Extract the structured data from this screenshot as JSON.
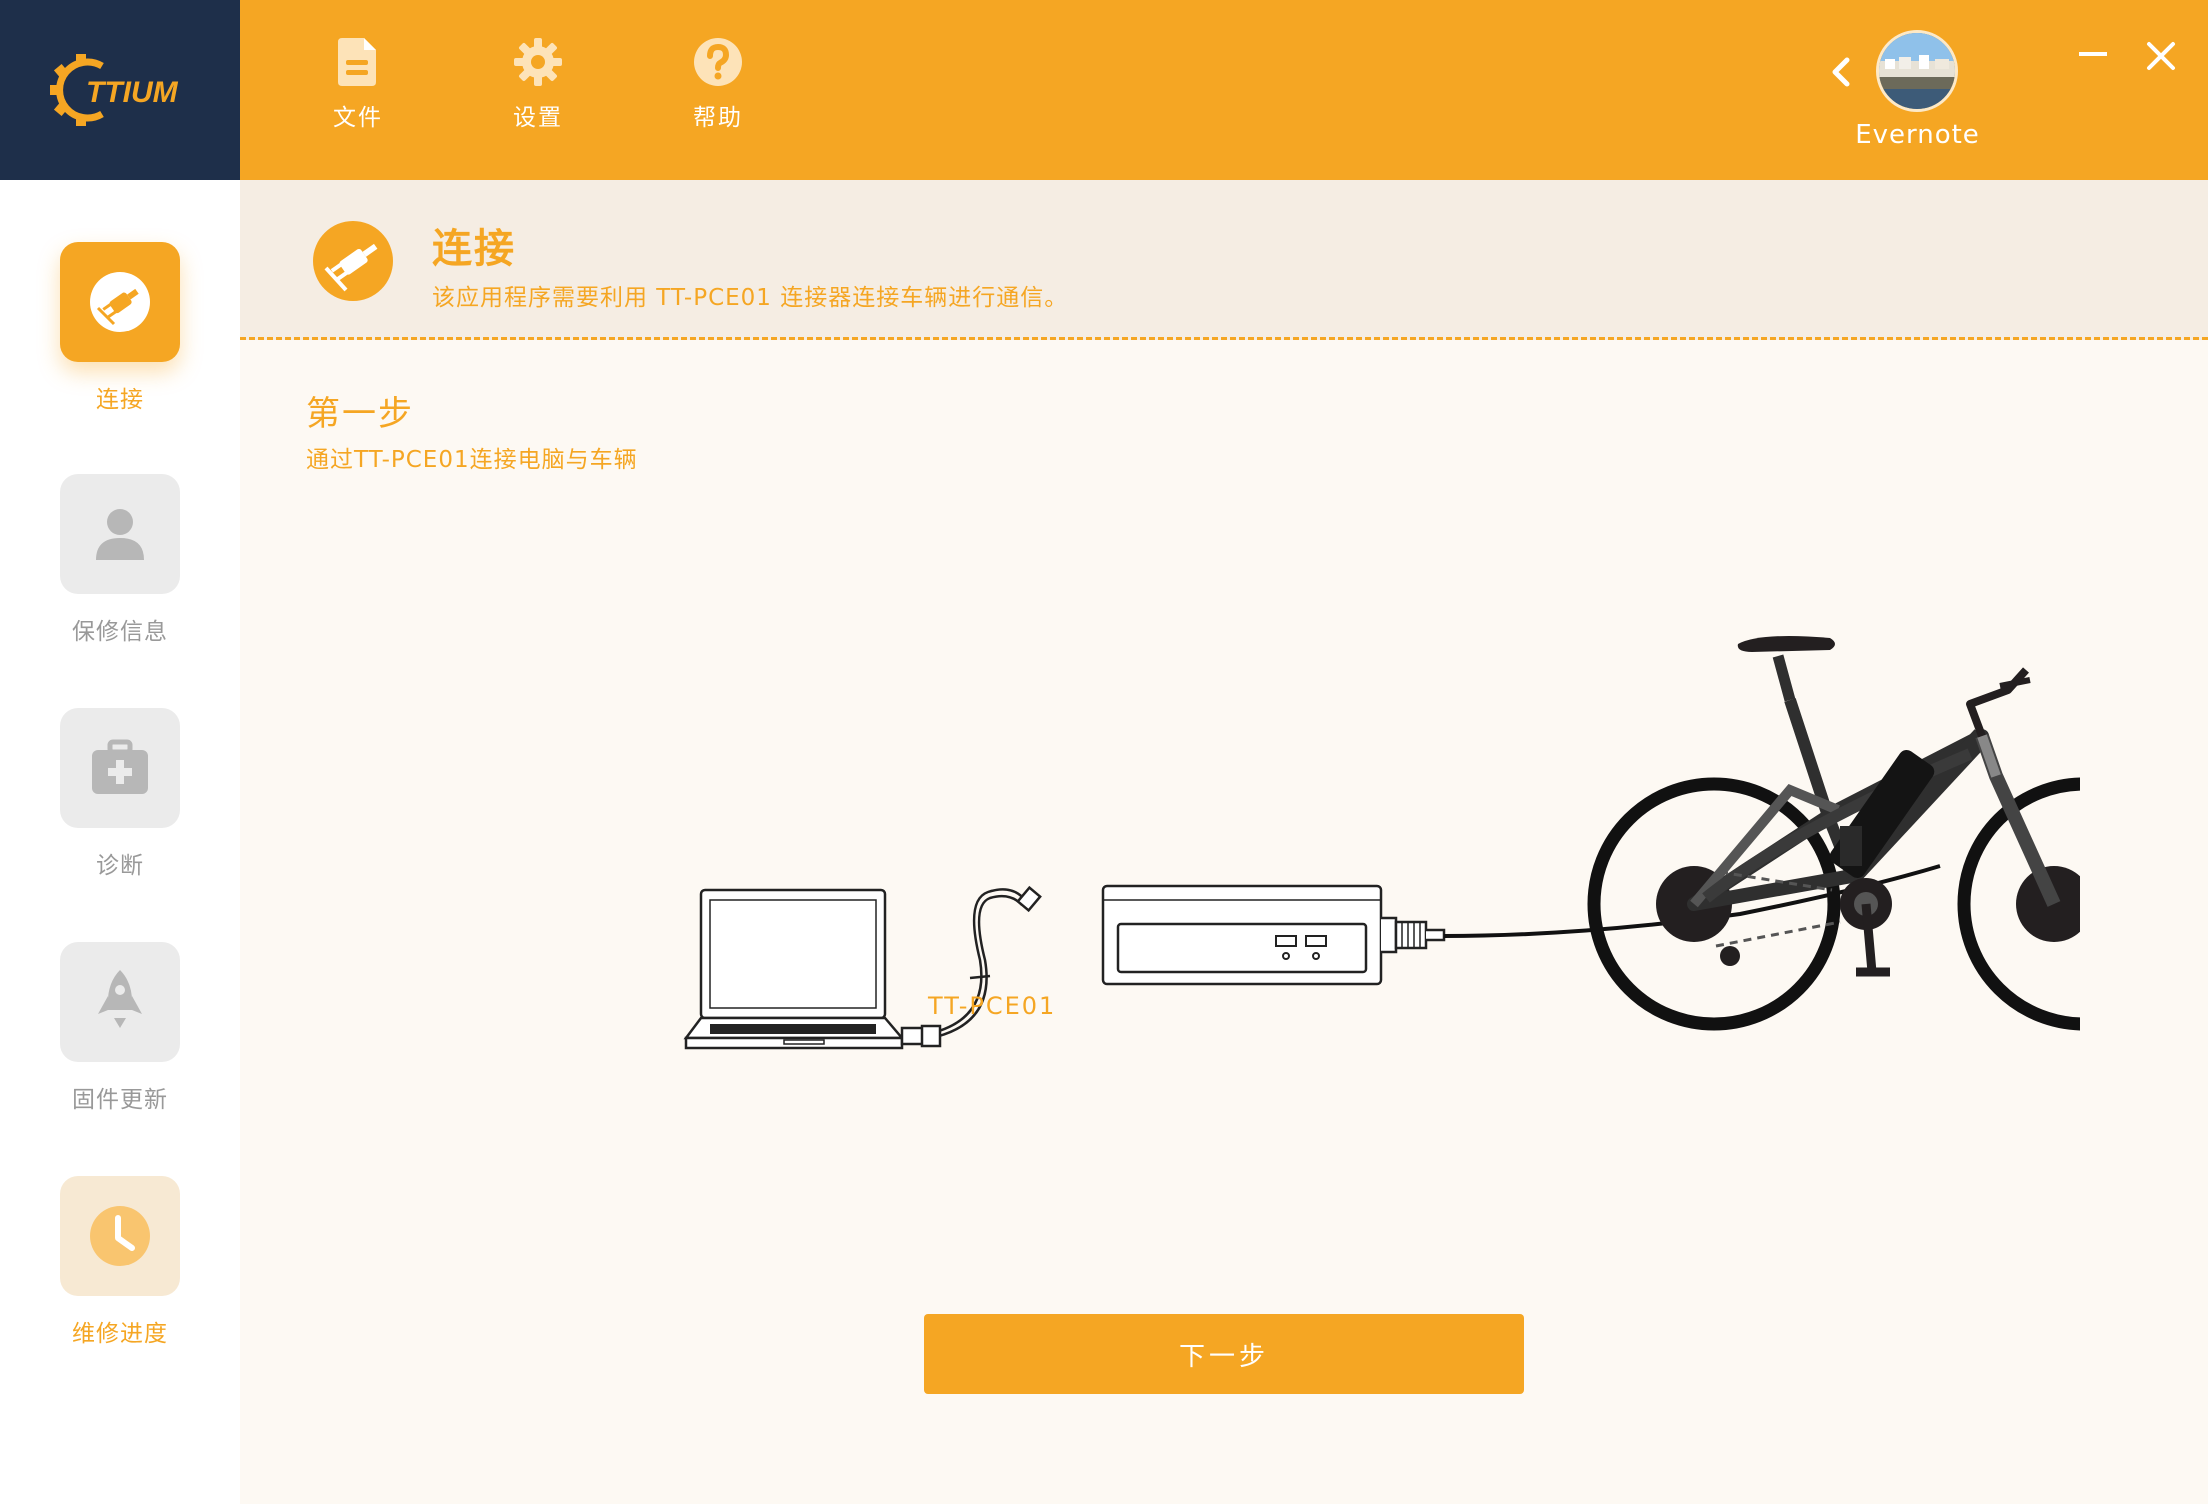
{
  "app": {
    "logo_text": "TTIUM",
    "brand_color": "#f5a623",
    "logo_bg": "#1e2f4a"
  },
  "toolbar": {
    "file_label": "文件",
    "settings_label": "设置",
    "help_label": "帮助"
  },
  "user": {
    "name": "Evernote"
  },
  "sidebar": {
    "items": [
      {
        "label": "连接",
        "icon": "plug-icon",
        "active": true
      },
      {
        "label": "保修信息",
        "icon": "user-icon",
        "active": false
      },
      {
        "label": "诊断",
        "icon": "medkit-icon",
        "active": false
      },
      {
        "label": "固件更新",
        "icon": "rocket-icon",
        "active": false
      },
      {
        "label": "维修进度",
        "icon": "clock-icon",
        "active": false
      }
    ]
  },
  "header": {
    "title": "连接",
    "subtitle": "该应用程序需要利用 TT-PCE01 连接器连接车辆进行通信。"
  },
  "step": {
    "title": "第一步",
    "subtitle": "通过TT-PCE01连接电脑与车辆"
  },
  "diagram": {
    "device_label": "TT-PCE01"
  },
  "actions": {
    "next_label": "下一步"
  }
}
